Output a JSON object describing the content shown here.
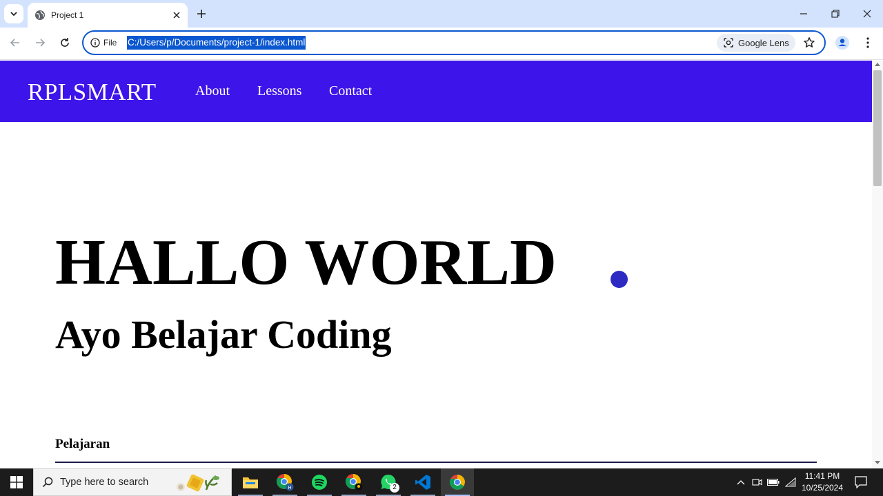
{
  "browser": {
    "tab": {
      "title": "Project 1"
    },
    "omnibox": {
      "scheme_label": "File",
      "url": "C:/Users/p/Documents/project-1/index.html",
      "lens_label": "Google Lens"
    }
  },
  "site": {
    "brand": "RPLSMART",
    "nav": {
      "about": "About",
      "lessons": "Lessons",
      "contact": "Contact"
    },
    "hero": {
      "title": "HALLO WORLD",
      "subtitle": "Ayo Belajar Coding"
    },
    "section_title": "Pelajaran",
    "colors": {
      "navbar": "#3d14e9",
      "dot": "#2d2ac4"
    }
  },
  "taskbar": {
    "search_placeholder": "Type here to search",
    "apps": [
      "file-explorer",
      "chrome-profile-h",
      "spotify",
      "chrome-profile-2",
      "whatsapp",
      "vscode",
      "chrome-active"
    ],
    "whatsapp_badge": "2",
    "clock": {
      "time": "11:41 PM",
      "date": "10/25/2024"
    }
  }
}
